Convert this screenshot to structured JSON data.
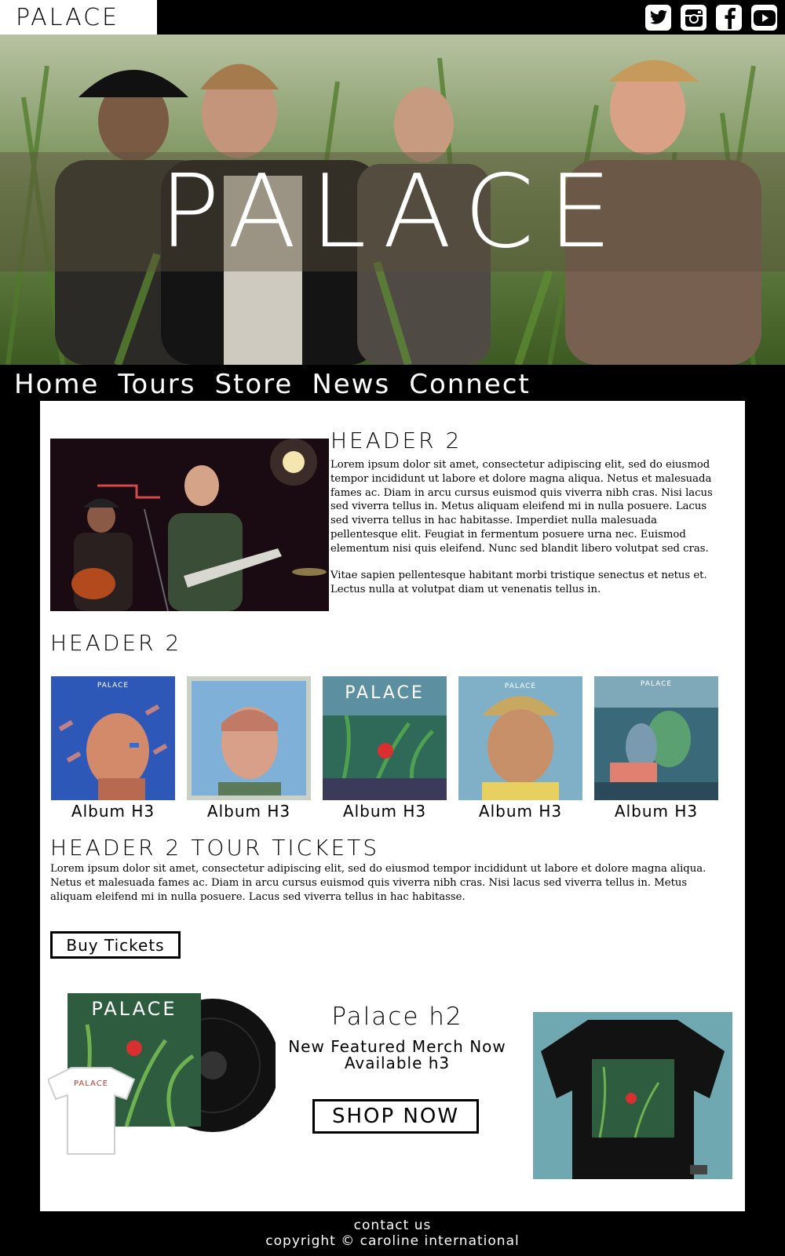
{
  "header": {
    "logo": "PALACE",
    "social": [
      {
        "icon": "twitter-icon"
      },
      {
        "icon": "instagram-icon"
      },
      {
        "icon": "facebook-icon"
      },
      {
        "icon": "youtube-icon"
      }
    ]
  },
  "hero": {
    "title": "PALACE"
  },
  "nav": {
    "items": [
      "Home",
      "Tours",
      "Store",
      "News",
      "Connect"
    ]
  },
  "intro": {
    "heading": "HEADER 2",
    "paragraph1": "Lorem ipsum dolor sit amet, consectetur adipiscing elit, sed do eiusmod tempor incididunt ut labore et dolore magna aliqua. Netus et malesuada fames ac. Diam in arcu cursus euismod quis viverra nibh cras. Nisi lacus sed viverra tellus in. Metus aliquam eleifend mi in nulla posuere. Lacus sed viverra tellus in hac habitasse. Imperdiet nulla malesuada pellentesque elit. Feugiat in fermentum posuere urna nec. Euismod elementum nisi quis eleifend. Nunc sed blandit libero volutpat sed cras.",
    "paragraph2": "Vitae sapien pellentesque habitant morbi tristique senectus et netus et. Lectus nulla at volutpat diam ut venenatis tellus in."
  },
  "albums": {
    "heading": "HEADER 2",
    "items": [
      {
        "caption": "Album H3",
        "cover_text": "PALACE"
      },
      {
        "caption": "Album H3",
        "cover_text": ""
      },
      {
        "caption": "Album H3",
        "cover_text": "PALACE"
      },
      {
        "caption": "Album H3",
        "cover_text": "PALACE"
      },
      {
        "caption": "Album H3",
        "cover_text": "PALACE"
      }
    ]
  },
  "tour": {
    "heading": "HEADER 2 TOUR TICKETS",
    "paragraph": "Lorem ipsum dolor sit amet, consectetur adipiscing elit, sed do eiusmod tempor incididunt ut labore et dolore magna aliqua. Netus et malesuada fames ac. Diam in arcu cursus euismod quis viverra nibh cras. Nisi lacus sed viverra tellus in. Metus aliquam eleifend mi in nulla posuere. Lacus sed viverra tellus in hac habitasse.",
    "button": "Buy Tickets"
  },
  "merch": {
    "heading": "Palace h2",
    "subheading": "New Featured Merch Now Available h3",
    "button": "SHOP NOW",
    "art_text": "PALACE",
    "tshirt_text": "PALACE"
  },
  "footer": {
    "contact": "contact us",
    "copyright": "copyright ©  caroline international"
  }
}
